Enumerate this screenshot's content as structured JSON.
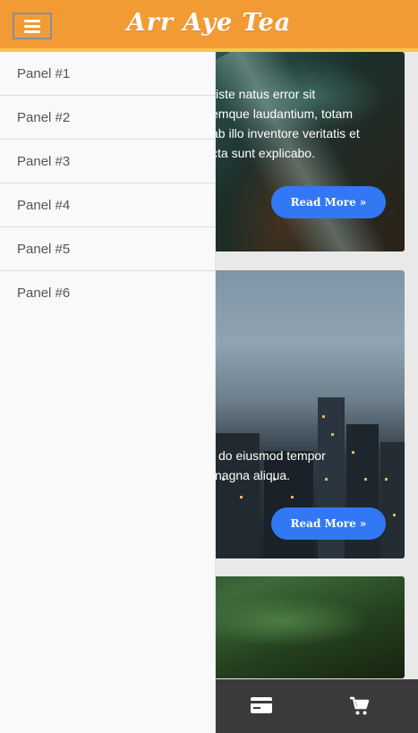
{
  "header": {
    "title": "Arr Aye Tea",
    "menu_icon": "hamburger-icon"
  },
  "side_panel": {
    "items": [
      {
        "label": "Panel #1"
      },
      {
        "label": "Panel #2"
      },
      {
        "label": "Panel #3"
      },
      {
        "label": "Panel #4"
      },
      {
        "label": "Panel #5"
      },
      {
        "label": "Panel #6"
      }
    ]
  },
  "cards": [
    {
      "lines": [
        "iste natus error sit",
        "emque laudantium, totam",
        "ab illo inventore veritatis et",
        "cta sunt explicabo."
      ],
      "button": "Read More »"
    },
    {
      "lines": [
        "do eiusmod tempor",
        "nagna aliqua."
      ],
      "button": "Read More »"
    },
    {
      "lines": [],
      "button": ""
    }
  ],
  "bottom_bar": {
    "icons": [
      "credit-card-icon",
      "cart-icon"
    ]
  },
  "colors": {
    "header": "#f29b35",
    "header_border": "#f6c64a",
    "button": "#3278f5",
    "bottom_bar": "#3a3a3a",
    "panel_bg": "#f8f9fa"
  }
}
